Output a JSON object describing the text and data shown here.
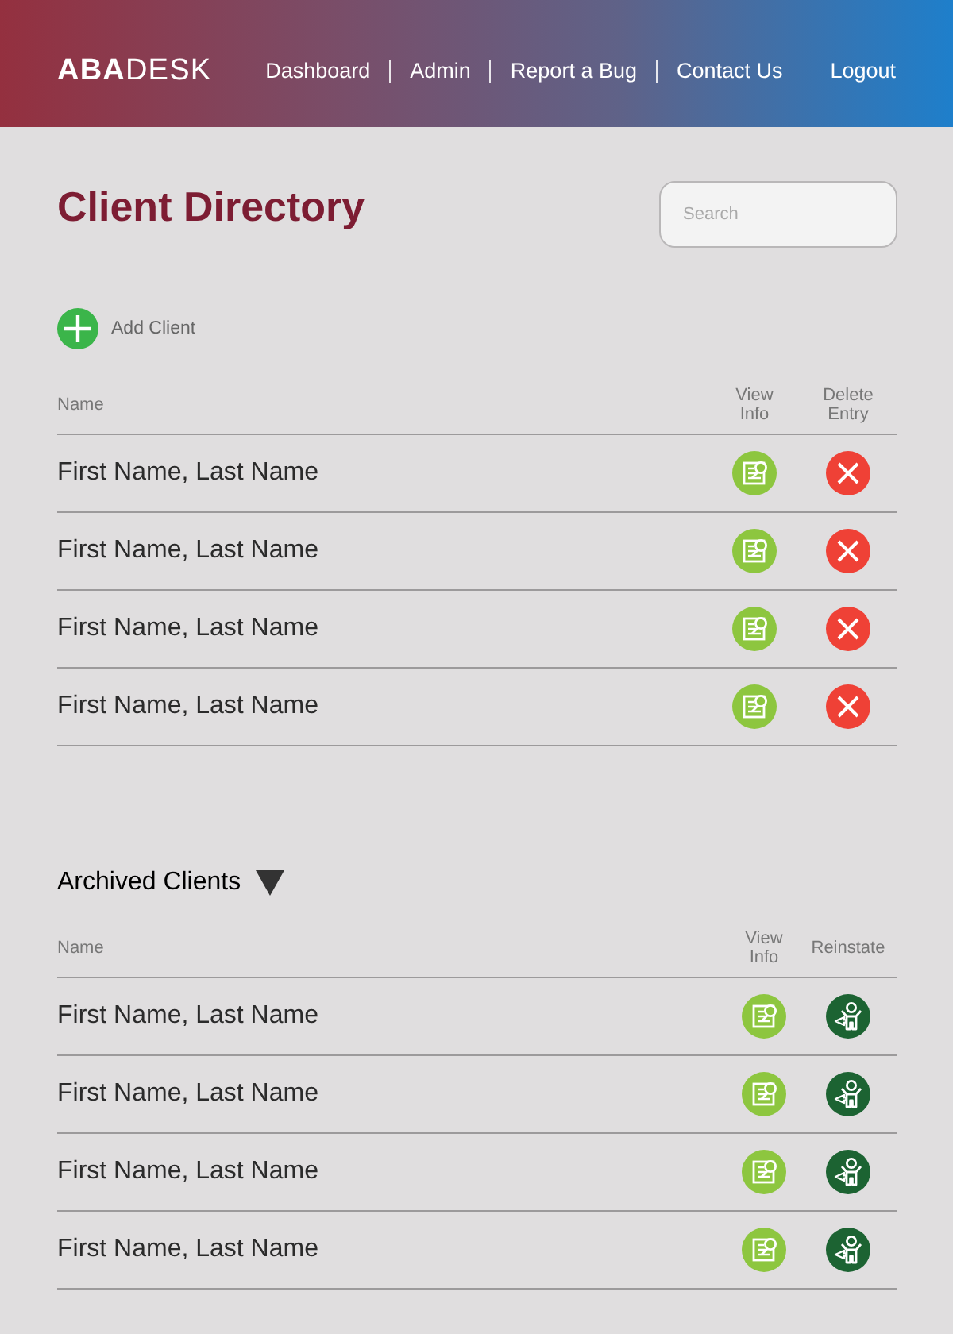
{
  "header": {
    "logo": "**ABA**DESK",
    "nav": [
      {
        "label": "Dashboard"
      },
      {
        "label": "Admin"
      },
      {
        "label": "Report a Bug"
      },
      {
        "label": "Contact Us"
      }
    ],
    "logout": "Logout"
  },
  "title": "Client Directory",
  "search": {
    "placeholder": "Search"
  },
  "add_client": {
    "label": "Add Client"
  },
  "clients_table": {
    "columns": [
      {
        "label": "Name",
        "kind": "name"
      },
      {
        "label": "View Info",
        "kind": "view"
      },
      {
        "label": "Delete Entry",
        "kind": "delete"
      }
    ],
    "rows": [
      {
        "name": "First Name, Last Name"
      },
      {
        "name": "First Name, Last Name"
      },
      {
        "name": "First Name, Last Name"
      },
      {
        "name": "First Name, Last Name"
      }
    ]
  },
  "archived": {
    "title": "Archived Clients",
    "expanded": true,
    "table": {
      "columns": [
        {
          "label": "Name",
          "kind": "name"
        },
        {
          "label": "View Info",
          "kind": "view"
        },
        {
          "label": "Reinstate",
          "kind": "reinstate"
        }
      ],
      "rows": [
        {
          "name": "First Name, Last Name"
        },
        {
          "name": "First Name, Last Name"
        },
        {
          "name": "First Name, Last Name"
        },
        {
          "name": "First Name, Last Name"
        }
      ]
    }
  }
}
